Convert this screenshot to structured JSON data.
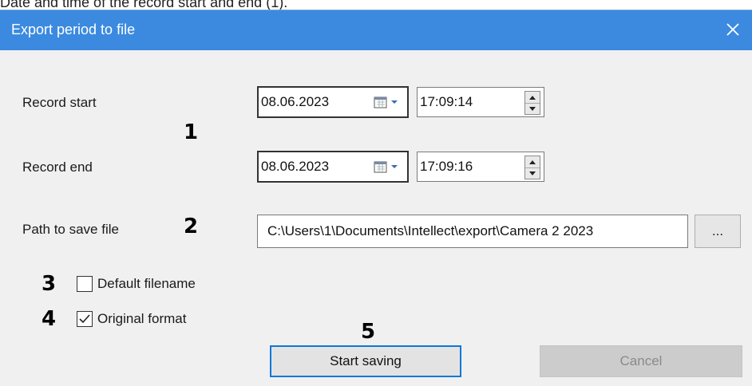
{
  "caption": "Date and time of the record start and end (1).",
  "window": {
    "title": "Export period to file",
    "close_glyph": "✕"
  },
  "record_start": {
    "label": "Record start",
    "date": "08.06.2023",
    "time": "17:09:14"
  },
  "record_end": {
    "label": "Record end",
    "date": "08.06.2023",
    "time": "17:09:16"
  },
  "path": {
    "label": "Path to save file",
    "value": "C:\\Users\\1\\Documents\\Intellect\\export\\Camera 2 2023",
    "browse_label": "..."
  },
  "options": {
    "default_filename": {
      "label": "Default filename",
      "checked": false
    },
    "original_format": {
      "label": "Original format",
      "checked": true
    }
  },
  "buttons": {
    "start": "Start saving",
    "cancel": "Cancel"
  },
  "markers": {
    "m1": "1",
    "m2": "2",
    "m3": "3",
    "m4": "4",
    "m5": "5"
  },
  "colors": {
    "titlebar": "#3b8ae0",
    "dialog_bg": "#f0f0f0",
    "focus_border": "#0a78d7"
  },
  "icons": {
    "calendar": "calendar-icon",
    "spin_up": "spin-up-icon",
    "spin_down": "spin-down-icon",
    "checkmark": "checkmark-icon"
  }
}
